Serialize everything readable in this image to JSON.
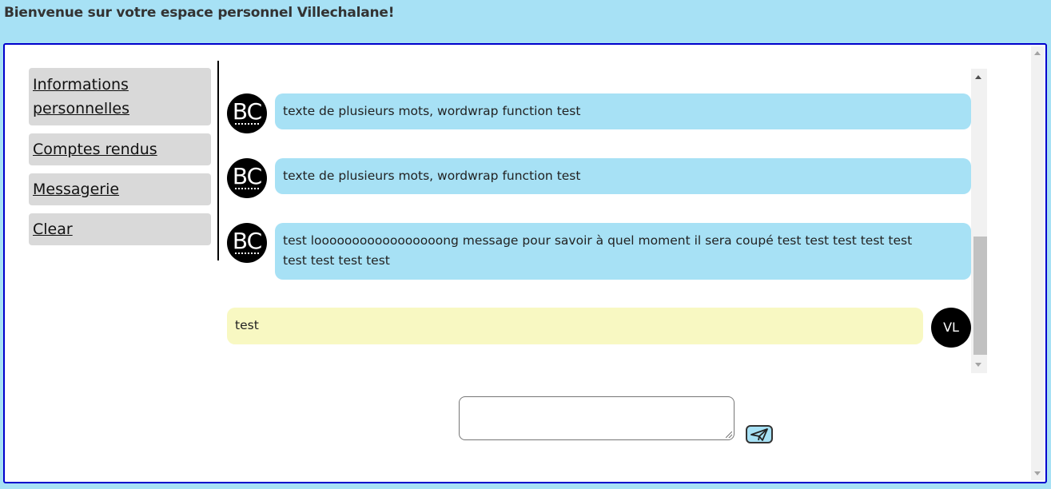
{
  "header": {
    "title": "Bienvenue sur votre espace personnel Villechalane!"
  },
  "sidebar": {
    "items": [
      {
        "label_line1": "Informations",
        "label_line2": "personnelles"
      },
      {
        "label": "Comptes rendus"
      },
      {
        "label": "Messagerie"
      },
      {
        "label": "Clear"
      }
    ]
  },
  "chat": {
    "messages": [
      {
        "direction": "incoming",
        "avatar": "BC",
        "text": "texte de plusieurs mots, wordwrap function test"
      },
      {
        "direction": "incoming",
        "avatar": "BC",
        "text": "texte de plusieurs mots, wordwrap function test"
      },
      {
        "direction": "incoming",
        "avatar": "BC",
        "text_line1": "test looooooooooooooooong message pour savoir à quel moment il sera coupé test test test test test",
        "text_line2": "test test test test"
      },
      {
        "direction": "outgoing",
        "avatar": "VL",
        "text": "test"
      }
    ]
  },
  "composer": {
    "value": "",
    "send_icon": "paper-plane-icon"
  },
  "colors": {
    "background": "#a7e1f5",
    "frame_border": "#0000cc",
    "incoming_bubble": "#a7e1f5",
    "outgoing_bubble": "#f8f8c2",
    "nav_item": "#d9d9d9"
  }
}
